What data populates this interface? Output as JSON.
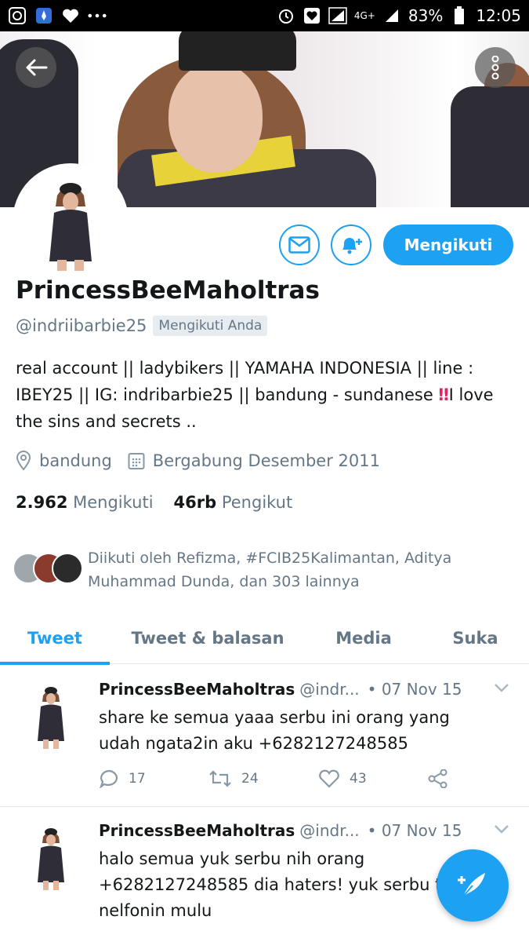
{
  "status_bar": {
    "network": "4G+",
    "battery": "83%",
    "time": "12:05",
    "left_icons": [
      "whatsapp-icon",
      "rocket-icon",
      "heart-icon",
      "more-dots-icon"
    ],
    "right_icons": [
      "alarm-icon",
      "heart-box-icon",
      "signal-icon",
      "battery-icon"
    ]
  },
  "profile": {
    "display_name": "PrincessBeeMaholtras",
    "handle": "@indriibarbie25",
    "follows_you": "Mengikuti Anda",
    "bio_part1": "real account || ladybikers || YAMAHA INDONESIA || line : IBEY25 || IG: indribarbie25 || bandung - sundanese ",
    "bio_alert": "‼",
    "bio_part2": "I love the sins and secrets ..",
    "location": "bandung",
    "joined": "Bergabung Desember 2011",
    "following_count": "2.962",
    "following_label": "Mengikuti",
    "followers_count": "46rb",
    "followers_label": "Pengikut",
    "followed_by": "Diikuti oleh Refizma, #FCIB25Kalimantan, Aditya Muhammad Dunda, dan 303 lainnya"
  },
  "actions": {
    "follow_label": "Mengikuti"
  },
  "tabs": [
    {
      "label": "Tweet",
      "active": true
    },
    {
      "label": "Tweet & balasan",
      "active": false
    },
    {
      "label": "Media",
      "active": false
    },
    {
      "label": "Suka",
      "active": false
    }
  ],
  "tweets": [
    {
      "name": "PrincessBeeMaholtras",
      "handle": "@indr...",
      "date": "• 07 Nov 15",
      "text": "share ke semua yaaa serbu ini orang yang udah ngata2in aku +6282127248585",
      "replies": "17",
      "retweets": "24",
      "likes": "43"
    },
    {
      "name": "PrincessBeeMaholtras",
      "handle": "@indr...",
      "date": "• 07 Nov 15",
      "text": "halo semua yuk serbu nih orang +6282127248585 dia haters! yuk serbu tadi nelfonin mulu"
    }
  ],
  "colors": {
    "accent": "#1da1f2",
    "secondary_text": "#657786",
    "alert": "#e0245e"
  }
}
